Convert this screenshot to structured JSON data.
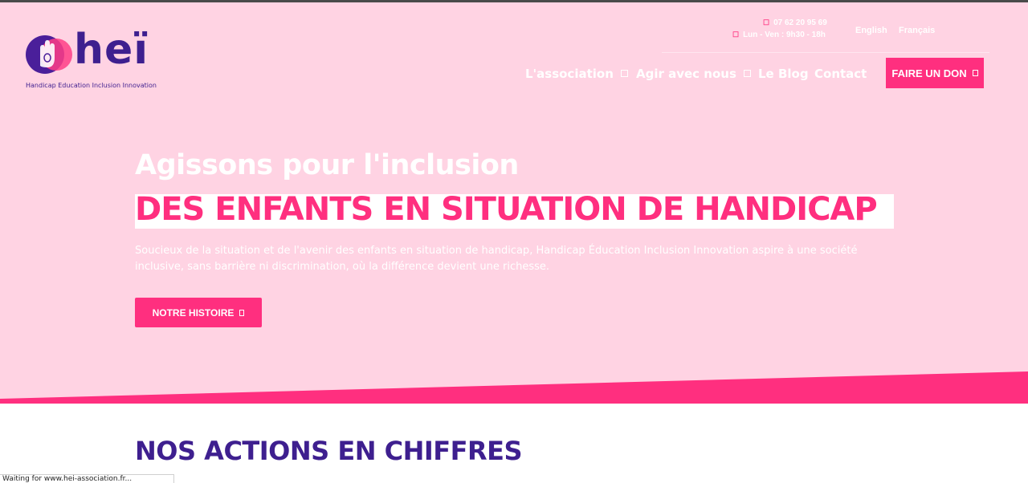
{
  "brand": {
    "name": "heï",
    "tagline": "Handicap Education Inclusion Innovation"
  },
  "header": {
    "phone": "07 62 20 95 69",
    "hours": "Lun - Ven : 9h30 - 18h",
    "languages": [
      "English",
      "Français"
    ]
  },
  "nav": {
    "items": [
      {
        "label": "L'association",
        "has_dropdown": true
      },
      {
        "label": "Agir avec nous",
        "has_dropdown": true
      },
      {
        "label": "Le Blog",
        "has_dropdown": false
      },
      {
        "label": "Contact",
        "has_dropdown": false
      }
    ],
    "donate_label": "FAIRE UN DON"
  },
  "hero": {
    "title": "Agissons pour l'inclusion",
    "subtitle": "DES ENFANTS EN SITUATION DE HANDICAP",
    "description": "Soucieux de la situation et de l'avenir des enfants en situation de handicap, Handicap Éducation Inclusion Innovation aspire à une société inclusive, sans barrière ni discrimination, où la différence devient une richesse.",
    "cta_label": "NOTRE HISTOIRE"
  },
  "section": {
    "title": "NOS ACTIONS EN CHIFFRES"
  },
  "status_bar": {
    "text": "Waiting for www.hei-association.fr..."
  },
  "colors": {
    "hero_bg": "#ffd3e3",
    "accent": "#ff2f7f",
    "brand_purple": "#3e1f8f",
    "white": "#ffffff"
  },
  "icons": {
    "phone": "phone-icon",
    "clock": "clock-icon",
    "dropdown": "chevron-down-icon",
    "arrow": "arrow-right-icon"
  }
}
